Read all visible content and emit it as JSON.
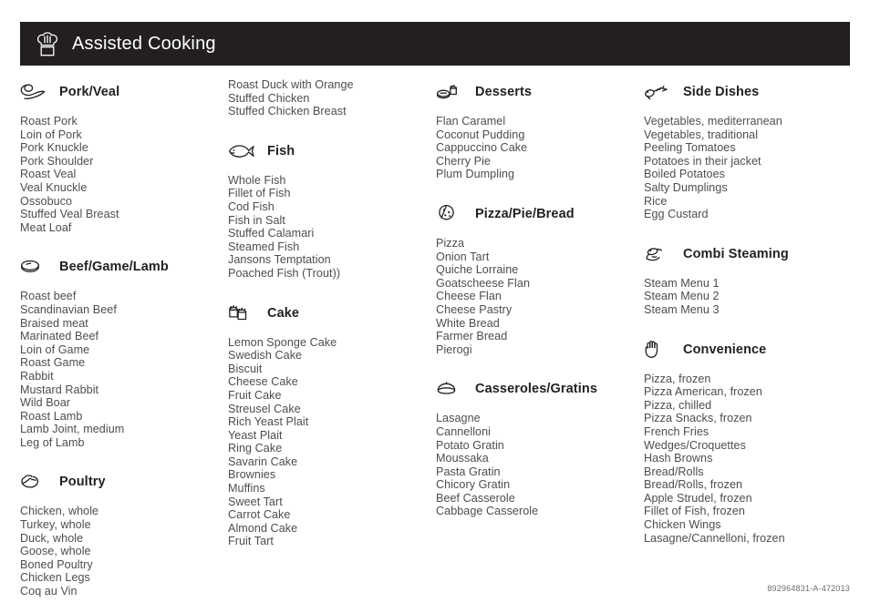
{
  "header": {
    "title": "Assisted Cooking",
    "icon": "chef-hat-icon",
    "background_color": "#231f20",
    "text_color": "#ffffff"
  },
  "footer": {
    "code": "892964831-A-472013"
  },
  "columns": [
    {
      "id": "column-1",
      "blocks": [
        {
          "type": "category",
          "id": "pork-veal",
          "title": "Pork/Veal",
          "icon": "ham-icon",
          "items": [
            "Roast Pork",
            "Loin of Pork",
            "Pork Knuckle",
            "Pork Shoulder",
            "Roast Veal",
            "Veal Knuckle",
            "Ossobuco",
            "Stuffed Veal Breast",
            "Meat Loaf"
          ]
        },
        {
          "type": "category",
          "id": "beef-game-lamb",
          "title": "Beef/Game/Lamb",
          "icon": "steak-icon",
          "items": [
            "Roast beef",
            "Scandinavian Beef",
            "Braised meat",
            "Marinated Beef",
            "Loin of Game",
            "Roast Game",
            "Rabbit",
            "Mustard Rabbit",
            "Wild Boar",
            "Roast Lamb",
            "Lamb Joint, medium",
            "Leg of Lamb"
          ]
        },
        {
          "type": "category",
          "id": "poultry",
          "title": "Poultry",
          "icon": "poultry-icon",
          "items": [
            "Chicken, whole",
            "Turkey, whole",
            "Duck, whole",
            "Goose, whole",
            "Boned Poultry",
            "Chicken Legs",
            "Coq au Vin"
          ]
        }
      ]
    },
    {
      "id": "column-2",
      "blocks": [
        {
          "type": "continuation",
          "id": "poultry-continued",
          "items": [
            "Roast Duck with Orange",
            "Stuffed Chicken",
            "Stuffed Chicken Breast"
          ]
        },
        {
          "type": "category",
          "id": "fish",
          "title": "Fish",
          "icon": "fish-icon",
          "items": [
            "Whole Fish",
            "Fillet of Fish",
            "Cod Fish",
            "Fish in Salt",
            "Stuffed Calamari",
            "Steamed Fish",
            "Jansons Temptation",
            "Poached Fish (Trout))"
          ]
        },
        {
          "type": "category",
          "id": "cake",
          "title": "Cake",
          "icon": "cake-icon",
          "items": [
            "Lemon Sponge Cake",
            "Swedish Cake",
            "Biscuit",
            "Cheese Cake",
            "Fruit Cake",
            "Streusel Cake",
            "Rich Yeast Plait",
            "Yeast Plait",
            "Ring Cake",
            "Savarin Cake",
            "Brownies",
            "Muffins",
            "Sweet Tart",
            "Carrot Cake",
            "Almond Cake",
            "Fruit Tart"
          ]
        }
      ]
    },
    {
      "id": "column-3",
      "blocks": [
        {
          "type": "category",
          "id": "desserts",
          "title": "Desserts",
          "icon": "dessert-icon",
          "items": [
            "Flan Caramel",
            "Coconut Pudding",
            "Cappuccino Cake",
            "Cherry Pie",
            "Plum Dumpling"
          ]
        },
        {
          "type": "category",
          "id": "pizza-pie-bread",
          "title": "Pizza/Pie/Bread",
          "icon": "pizza-icon",
          "items": [
            "Pizza",
            "Onion Tart",
            "Quiche Lorraine",
            "Goatscheese Flan",
            "Cheese Flan",
            "Cheese Pastry",
            "White Bread",
            "Farmer Bread",
            "Pierogi"
          ]
        },
        {
          "type": "category",
          "id": "casseroles-gratins",
          "title": "Casseroles/Gratins",
          "icon": "casserole-pot-icon",
          "items": [
            "Lasagne",
            "Cannelloni",
            "Potato Gratin",
            "Moussaka",
            "Pasta Gratin",
            "Chicory Gratin",
            "Beef Casserole",
            "Cabbage Casserole"
          ]
        }
      ]
    },
    {
      "id": "column-4",
      "blocks": [
        {
          "type": "category",
          "id": "side-dishes",
          "title": "Side Dishes",
          "icon": "asparagus-icon",
          "items": [
            "Vegetables, mediterranean",
            "Vegetables, traditional",
            "Peeling Tomatoes",
            "Potatoes in their jacket",
            "Boiled Potatoes",
            "Salty Dumplings",
            "Rice",
            "Egg Custard"
          ]
        },
        {
          "type": "category",
          "id": "combi-steaming",
          "title": "Combi Steaming",
          "icon": "steam-pot-icon",
          "items": [
            "Steam Menu 1",
            "Steam Menu 2",
            "Steam Menu 3"
          ]
        },
        {
          "type": "category",
          "id": "convenience",
          "title": "Convenience",
          "icon": "hand-icon",
          "items": [
            "Pizza, frozen",
            "Pizza American, frozen",
            "Pizza, chilled",
            "Pizza Snacks, frozen",
            "French Fries",
            "Wedges/Croquettes",
            "Hash Browns",
            "Bread/Rolls",
            "Bread/Rolls, frozen",
            "Apple Strudel, frozen",
            "Fillet of Fish, frozen",
            "Chicken Wings",
            "Lasagne/Cannelloni, frozen"
          ]
        }
      ]
    }
  ]
}
